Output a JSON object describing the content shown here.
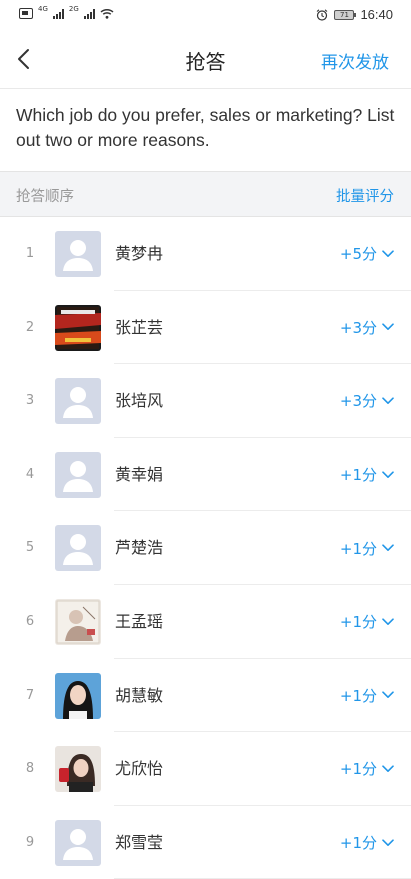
{
  "status": {
    "net1": "4G",
    "net2": "2G",
    "battery": "71",
    "time": "16:40"
  },
  "nav": {
    "title": "抢答",
    "action": "再次发放"
  },
  "question": {
    "text": "Which job do you prefer, sales or marketing? List out two or more reasons."
  },
  "section": {
    "label": "抢答顺序",
    "action": "批量评分"
  },
  "rows": [
    {
      "index": "1",
      "name": "黄梦冉",
      "score": "+5分",
      "avatar": "default"
    },
    {
      "index": "2",
      "name": "张芷芸",
      "score": "+3分",
      "avatar": "album-cover"
    },
    {
      "index": "3",
      "name": "张培风",
      "score": "+3分",
      "avatar": "default"
    },
    {
      "index": "4",
      "name": "黄幸娟",
      "score": "+1分",
      "avatar": "default"
    },
    {
      "index": "5",
      "name": "芦楚浩",
      "score": "+1分",
      "avatar": "default"
    },
    {
      "index": "6",
      "name": "王孟瑶",
      "score": "+1分",
      "avatar": "sketch-photo"
    },
    {
      "index": "7",
      "name": "胡慧敏",
      "score": "+1分",
      "avatar": "portrait-photo"
    },
    {
      "index": "8",
      "name": "尤欣怡",
      "score": "+1分",
      "avatar": "portrait-photo-red"
    },
    {
      "index": "9",
      "name": "郑雪莹",
      "score": "+1分",
      "avatar": "default"
    }
  ],
  "colors": {
    "accent": "#2196e8",
    "section_bg": "#f3f4f6",
    "avatar_default_bg": "#d3d9e7"
  },
  "icons": [
    "back-arrow-icon",
    "chevron-down-icon",
    "alarm-icon",
    "wifi-icon",
    "battery-icon",
    "signal-icon"
  ]
}
